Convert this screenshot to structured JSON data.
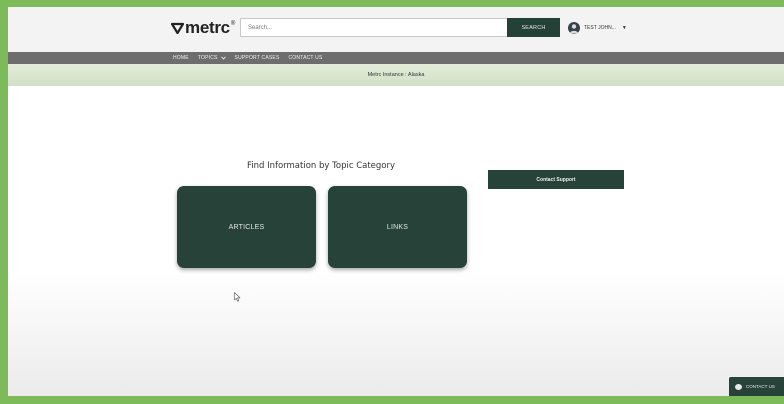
{
  "header": {
    "logo_text": "metrc",
    "logo_mark": "®",
    "search_placeholder": "Search...",
    "search_button": "SEARCH",
    "user_name": "TEST JOHN..."
  },
  "nav": {
    "items": [
      {
        "label": "HOME"
      },
      {
        "label": "TOPICS"
      },
      {
        "label": "SUPPORT CASES"
      },
      {
        "label": "CONTACT US"
      }
    ]
  },
  "instance_banner": "Metrc Instance : Alaska",
  "main": {
    "heading": "Find Information by Topic Category",
    "cards": [
      {
        "label": "ARTICLES"
      },
      {
        "label": "LINKS"
      }
    ],
    "contact_support": "Contact Support"
  },
  "chat_button": "CONTACT US",
  "colors": {
    "outer_border": "#7dba5a",
    "brand_dark": "#274239",
    "nav_bar": "#6d6d6d",
    "instance_banner": "#d9e5cf"
  },
  "icons": [
    "metrc-logo-icon",
    "user-avatar-icon",
    "chevron-down-icon",
    "mouse-cursor-icon",
    "chat-bubble-icon"
  ]
}
